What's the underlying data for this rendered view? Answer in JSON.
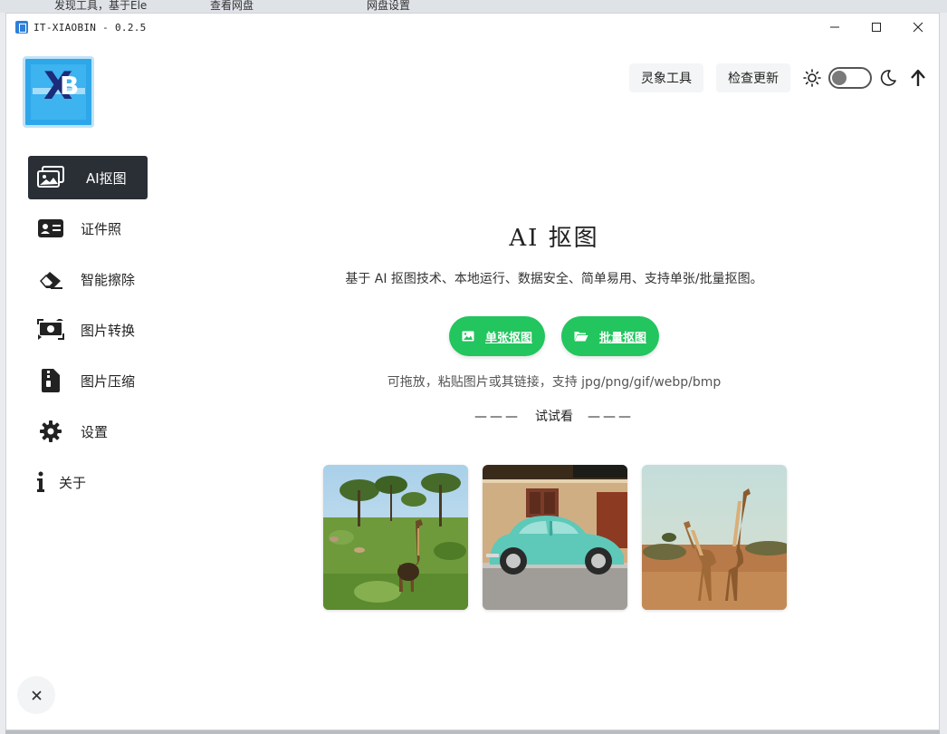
{
  "browser_tabs": [
    {
      "label": "发现工具，基于Ele"
    },
    {
      "label": "查看网盘"
    },
    {
      "label": "网盘设置"
    }
  ],
  "window": {
    "title": "IT-XIAOBIN - 0.2.5"
  },
  "logo": {
    "text": "XB"
  },
  "sidebar": {
    "items": [
      {
        "label": "AI抠图",
        "icon": "image-cutout-icon",
        "active": true
      },
      {
        "label": "证件照",
        "icon": "id-card-icon",
        "active": false
      },
      {
        "label": "智能擦除",
        "icon": "eraser-icon",
        "active": false
      },
      {
        "label": "图片转换",
        "icon": "convert-icon",
        "active": false
      },
      {
        "label": "图片压缩",
        "icon": "zip-file-icon",
        "active": false
      },
      {
        "label": "设置",
        "icon": "gear-icon",
        "active": false
      },
      {
        "label": "关于",
        "icon": "info-icon",
        "active": false
      }
    ],
    "collapse_label": "×"
  },
  "header": {
    "tools_label": "灵象工具",
    "update_label": "检查更新",
    "theme_dark": false
  },
  "main": {
    "title": "AI 抠图",
    "description": "基于 AI 抠图技术、本地运行、数据安全、简单易用、支持单张/批量抠图。",
    "single_button": "单张抠图",
    "batch_button": "批量抠图",
    "hint": "可拖放，粘贴图片或其链接，支持 jpg/png/gif/webp/bmp",
    "try_dash_left": "———",
    "try_label": "试试看",
    "try_dash_right": "———"
  },
  "samples": [
    {
      "name": "giraffe-savanna"
    },
    {
      "name": "turquoise-beetle-car"
    },
    {
      "name": "two-giraffes"
    }
  ],
  "colors": {
    "accent_green": "#22c55e",
    "sidebar_active": "#2a2f36"
  }
}
